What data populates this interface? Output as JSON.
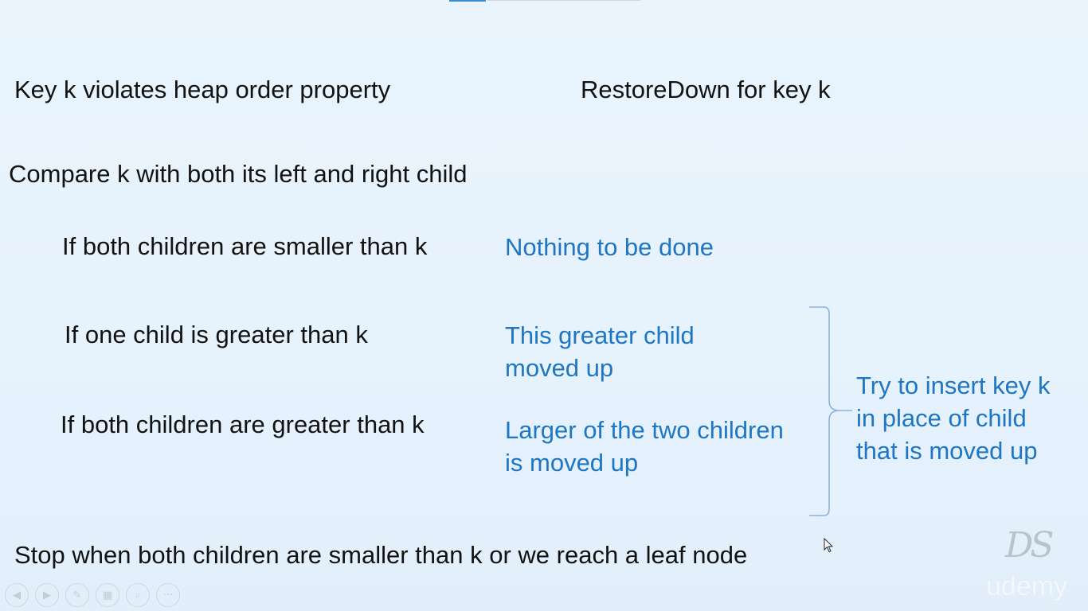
{
  "slide": {
    "heading_left": "Key k violates heap order property",
    "heading_right": "RestoreDown for key k",
    "compare_line": "Compare k with both its left and right child",
    "cases": [
      {
        "condition": "If both children are smaller than k",
        "action": "Nothing to be done"
      },
      {
        "condition": "If one child is greater than k",
        "action": "This greater child\nmoved up"
      },
      {
        "condition": "If both children are greater than k",
        "action": "Larger of the two children\nis moved up"
      }
    ],
    "brace_note": "Try to insert key k\nin place of child\nthat is moved up",
    "stop_line": "Stop when both children are smaller than k or we reach a leaf node"
  },
  "watermarks": {
    "logo_text": "DS",
    "udemy_text": "udemy"
  },
  "player_controls": {
    "icons": [
      "previous-icon",
      "next-icon",
      "pen-icon",
      "slides-icon",
      "zoom-icon",
      "more-icon"
    ],
    "labels": {
      "previous": "◀",
      "next": "▶",
      "pen": "✎",
      "slides": "▦",
      "zoom": "⌕",
      "more": "···"
    }
  },
  "colors": {
    "background": "#e7f3fd",
    "text": "#121212",
    "accent_blue": "#1f76c2",
    "brace": "#8fb3d6"
  }
}
